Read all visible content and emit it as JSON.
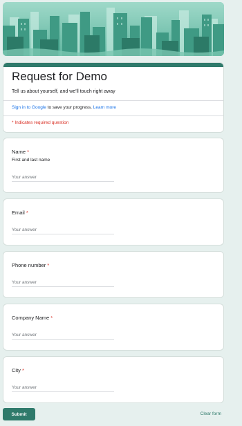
{
  "form": {
    "title": "Request for Demo",
    "description": "Tell us about yourself, and we'll touch right away",
    "signin_link": "Sign in to Google",
    "signin_text": " to save your progress. ",
    "learn_more": "Learn more",
    "required_note": "* Indicates required question"
  },
  "questions": [
    {
      "label": "Name",
      "required": "*",
      "help": "First and last name",
      "placeholder": "Your answer"
    },
    {
      "label": "Email",
      "required": "*",
      "placeholder": "Your answer"
    },
    {
      "label": "Phone number",
      "required": "*",
      "placeholder": "Your answer"
    },
    {
      "label": "Company Name",
      "required": "*",
      "placeholder": "Your answer"
    },
    {
      "label": "City",
      "required": "*",
      "placeholder": "Your answer"
    }
  ],
  "footer": {
    "submit_label": "Submit",
    "clear_label": "Clear form"
  },
  "colors": {
    "accent": "#2f7a6b",
    "required": "#d93025",
    "link": "#1a73e8",
    "background": "#e6f0ee"
  }
}
